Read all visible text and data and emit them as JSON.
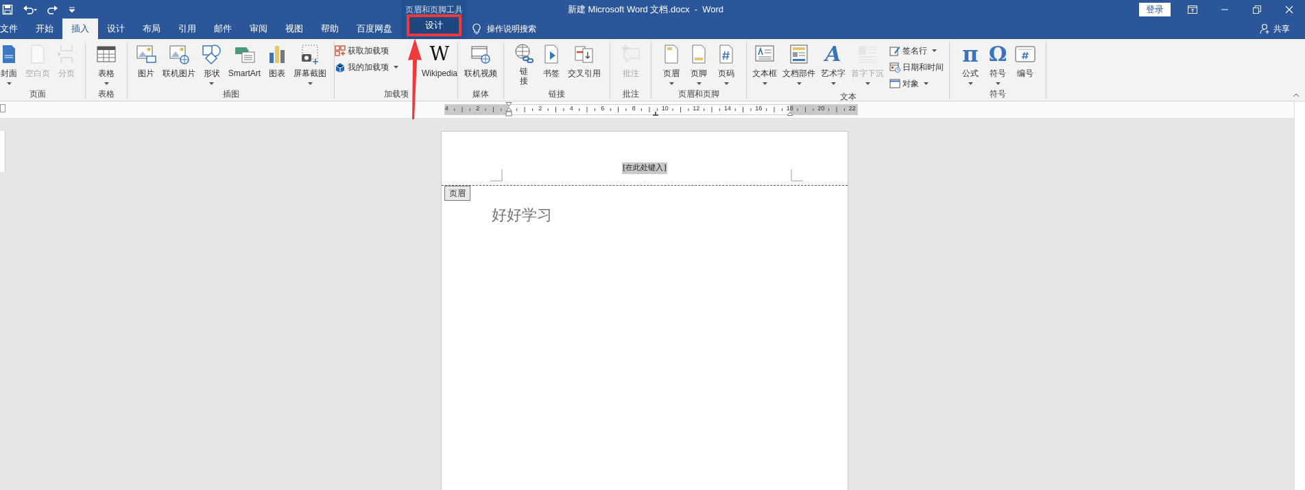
{
  "window": {
    "title": "新建 Microsoft Word 文档.docx  -  Word",
    "sign_in": "登录"
  },
  "tabs": [
    {
      "label": "文件",
      "selected": false
    },
    {
      "label": "开始",
      "selected": false
    },
    {
      "label": "插入",
      "selected": true
    },
    {
      "label": "设计",
      "selected": false
    },
    {
      "label": "布局",
      "selected": false
    },
    {
      "label": "引用",
      "selected": false
    },
    {
      "label": "邮件",
      "selected": false
    },
    {
      "label": "审阅",
      "selected": false
    },
    {
      "label": "视图",
      "selected": false
    },
    {
      "label": "帮助",
      "selected": false
    },
    {
      "label": "百度网盘",
      "selected": false
    }
  ],
  "contextual_tabs": {
    "title": "页眉和页脚工具",
    "tabs": [
      {
        "label": "设计",
        "selected": false,
        "highlighted": true
      }
    ]
  },
  "tell_me": "操作说明搜索",
  "share": "共享",
  "ribbon_groups": [
    {
      "label": "页面",
      "commands": [
        {
          "label": "封面",
          "kind": "large",
          "dropdown": true,
          "disabled": false
        },
        {
          "label": "空白页",
          "kind": "large",
          "dropdown": false,
          "disabled": true
        },
        {
          "label": "分页",
          "kind": "large",
          "dropdown": false,
          "disabled": true
        }
      ]
    },
    {
      "label": "表格",
      "commands": [
        {
          "label": "表格",
          "kind": "large",
          "dropdown": true,
          "disabled": false
        }
      ]
    },
    {
      "label": "插图",
      "commands": [
        {
          "label": "图片",
          "kind": "large",
          "dropdown": false,
          "disabled": false
        },
        {
          "label": "联机图片",
          "kind": "large",
          "dropdown": false,
          "disabled": false
        },
        {
          "label": "形状",
          "kind": "large",
          "dropdown": true,
          "disabled": false
        },
        {
          "label": "SmartArt",
          "kind": "large",
          "dropdown": false,
          "disabled": false
        },
        {
          "label": "图表",
          "kind": "large",
          "dropdown": false,
          "disabled": false
        },
        {
          "label": "屏幕截图",
          "kind": "large",
          "dropdown": true,
          "disabled": false
        }
      ]
    },
    {
      "label": "加载项",
      "commands": [
        {
          "label": "获取加载项",
          "kind": "small",
          "dropdown": false,
          "disabled": false
        },
        {
          "label": "我的加载项",
          "kind": "small",
          "dropdown": true,
          "disabled": false
        },
        {
          "label": "Wikipedia",
          "kind": "large",
          "dropdown": false,
          "disabled": false,
          "glyph": "W"
        }
      ]
    },
    {
      "label": "媒体",
      "commands": [
        {
          "label": "联机视频",
          "kind": "large",
          "dropdown": false,
          "disabled": false
        }
      ]
    },
    {
      "label": "链接",
      "commands": [
        {
          "label": "链接",
          "kind": "large",
          "dropdown": false,
          "disabled": false,
          "wrapped": true
        },
        {
          "label": "书签",
          "kind": "large",
          "dropdown": false,
          "disabled": false
        },
        {
          "label": "交叉引用",
          "kind": "large",
          "dropdown": false,
          "disabled": false
        }
      ]
    },
    {
      "label": "批注",
      "commands": [
        {
          "label": "批注",
          "kind": "large",
          "dropdown": false,
          "disabled": true
        }
      ]
    },
    {
      "label": "页眉和页脚",
      "commands": [
        {
          "label": "页眉",
          "kind": "large",
          "dropdown": true,
          "disabled": false
        },
        {
          "label": "页脚",
          "kind": "large",
          "dropdown": true,
          "disabled": false
        },
        {
          "label": "页码",
          "kind": "large",
          "dropdown": true,
          "disabled": false
        }
      ]
    },
    {
      "label": "文本",
      "commands": [
        {
          "label": "文本框",
          "kind": "large",
          "dropdown": true,
          "disabled": false
        },
        {
          "label": "文档部件",
          "kind": "large",
          "dropdown": true,
          "disabled": false
        },
        {
          "label": "艺术字",
          "kind": "large",
          "dropdown": true,
          "disabled": false,
          "glyph": "A"
        },
        {
          "label": "首字下沉",
          "kind": "large",
          "dropdown": true,
          "disabled": true
        },
        {
          "label": "签名行",
          "kind": "small",
          "dropdown": true,
          "disabled": false
        },
        {
          "label": "日期和时间",
          "kind": "small",
          "dropdown": false,
          "disabled": false
        },
        {
          "label": "对象",
          "kind": "small",
          "dropdown": true,
          "disabled": false
        }
      ]
    },
    {
      "label": "符号",
      "commands": [
        {
          "label": "公式",
          "kind": "large",
          "dropdown": true,
          "disabled": false,
          "glyph": "π"
        },
        {
          "label": "符号",
          "kind": "large",
          "dropdown": true,
          "disabled": false,
          "glyph": "Ω"
        },
        {
          "label": "编号",
          "kind": "large",
          "dropdown": false,
          "disabled": false
        }
      ]
    }
  ],
  "ruler": {
    "labels": [
      "4",
      "2",
      "2",
      "4",
      "6",
      "8",
      "10",
      "12",
      "14",
      "16",
      "18",
      "20",
      "22"
    ]
  },
  "document": {
    "header_text": "[在此处键入]",
    "header_tag": "页眉",
    "body": "好好学习"
  },
  "annotations": [
    {
      "kind": "arrow"
    }
  ]
}
